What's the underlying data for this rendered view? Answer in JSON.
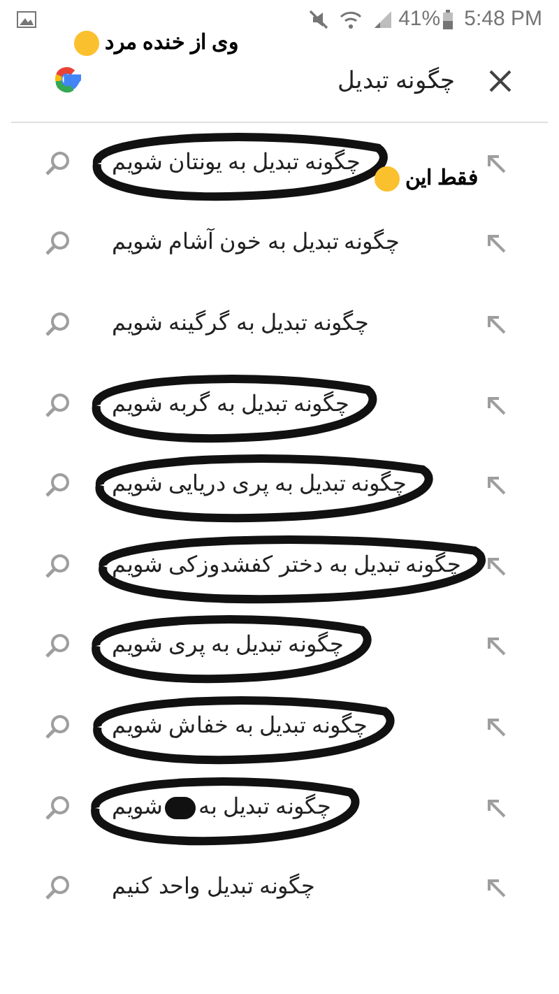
{
  "status_bar": {
    "battery": "41%",
    "time": "5:48 PM"
  },
  "annotations": [
    {
      "text": "وی از خنده مرد"
    },
    {
      "text": "فقط این"
    }
  ],
  "search": {
    "value": "چگونه تبدیل"
  },
  "suggestions": [
    {
      "text": "چگونه تبدیل به یونتان شویم",
      "circled": true
    },
    {
      "text": "چگونه تبدیل به خون آشام شویم",
      "circled": false
    },
    {
      "text": "چگونه تبدیل به گرگینه شویم",
      "circled": false
    },
    {
      "text": "چگونه تبدیل به گربه شویم",
      "circled": true
    },
    {
      "text": "چگونه تبدیل به پری دریایی شویم",
      "circled": true
    },
    {
      "text": "چگونه تبدیل به دختر کفشدوزکی شویم",
      "circled": true
    },
    {
      "text": "چگونه تبدیل به پری شویم",
      "circled": true
    },
    {
      "text": "چگونه تبدیل به خفاش شویم",
      "circled": true
    },
    {
      "text": "چگونه تبدیل به",
      "text_end": "شویم",
      "redacted": true,
      "circled": true
    },
    {
      "text": "چگونه تبدیل واحد کنیم",
      "circled": false
    }
  ]
}
